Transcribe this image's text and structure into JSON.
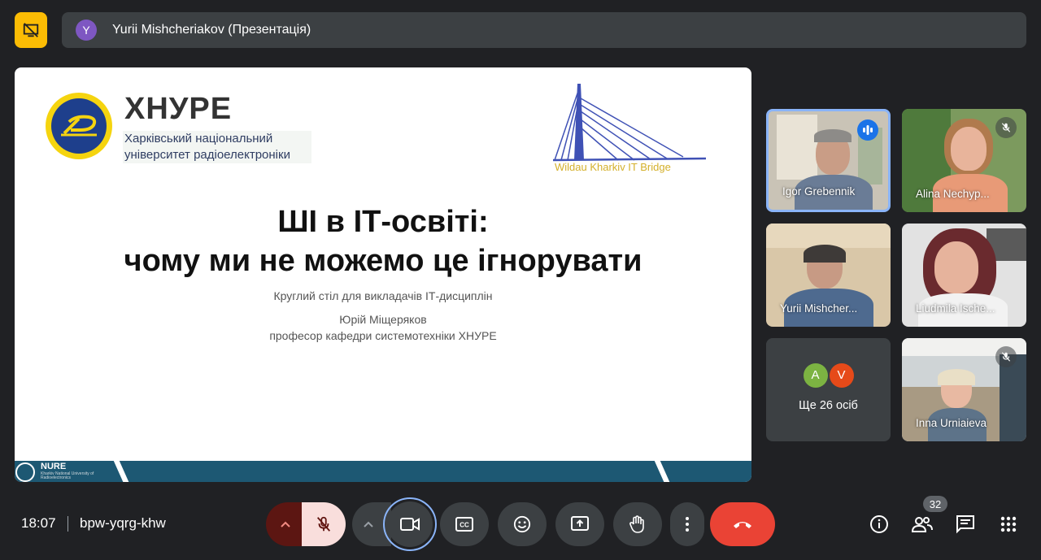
{
  "header": {
    "presenter_avatar_letter": "Y",
    "presenter_title": "Yurii Mishcheriakov (Презентація)"
  },
  "slide": {
    "university_short": "ХНУРЕ",
    "university_full_line1": "Харківський національний",
    "university_full_line2": "університет радіоелектроніки",
    "partner_logo_text": "Wildau Kharkiv IT Bridge",
    "title_line1": "ШІ в ІТ-освіті:",
    "title_line2": "чому ми не можемо це ігнорувати",
    "caption_event": "Круглий стіл для викладачів ІТ-дисциплін",
    "caption_author": "Юрій Міщеряков",
    "caption_position": "професор кафедри системотехніки ХНУРЕ",
    "footer_logo_text": "NURE",
    "footer_small_text": "Kharkiv National University of Radioelectronics"
  },
  "participants": [
    {
      "name": "Igor Grebennik",
      "status": "speaking"
    },
    {
      "name": "Alina Nechyp...",
      "status": "muted"
    },
    {
      "name": "Yurii Mishcher...",
      "status": "none"
    },
    {
      "name": "Liudmila Ische...",
      "status": "none"
    },
    {
      "name": "Inna Urniaieva",
      "status": "muted"
    }
  ],
  "more_participants": {
    "avatars": [
      {
        "letter": "A",
        "color": "#7cb342"
      },
      {
        "letter": "V",
        "color": "#e64a19"
      }
    ],
    "label": "Ще 26 осіб"
  },
  "footer": {
    "time": "18:07",
    "meeting_code": "bpw-yqrg-khw",
    "people_count": "32"
  },
  "colors": {
    "accent": "#8ab4f8",
    "end_call": "#ea4335",
    "pin": "#fbbc04"
  }
}
